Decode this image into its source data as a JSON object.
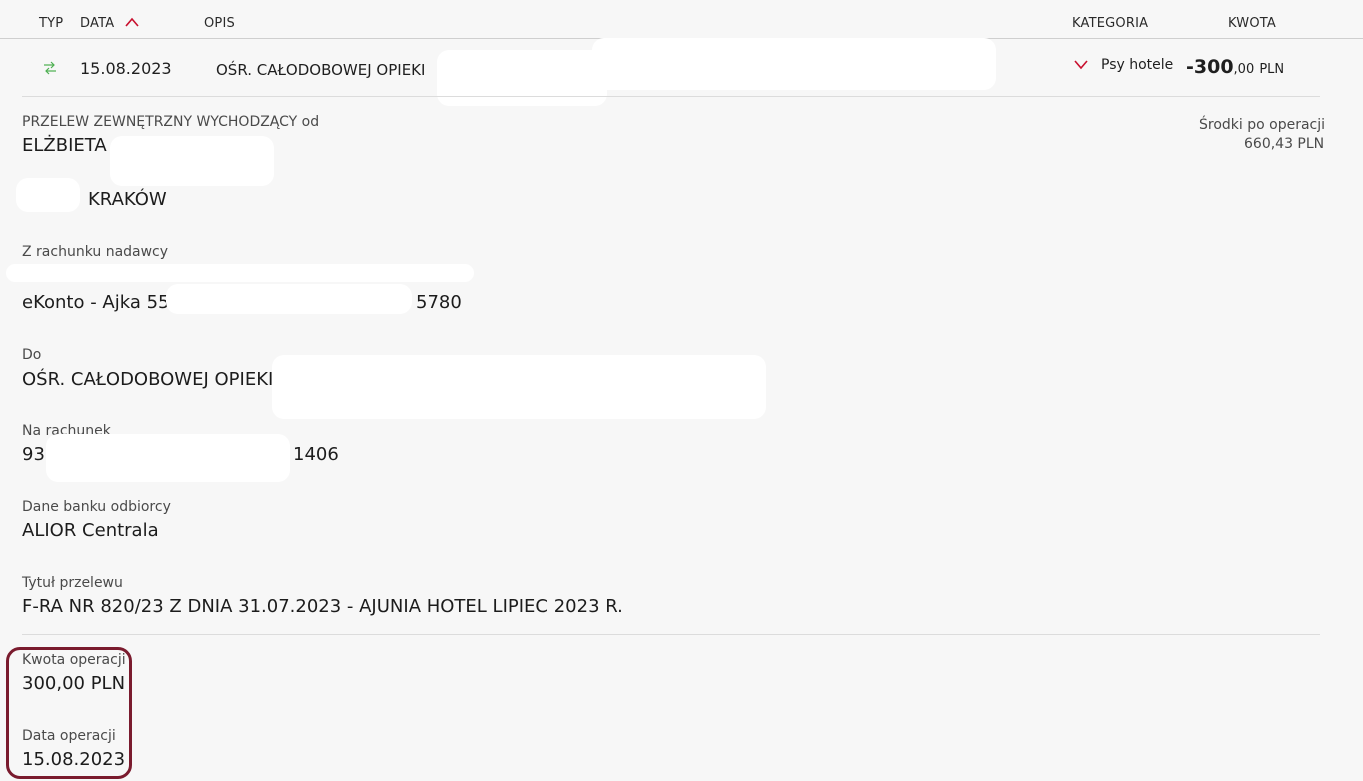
{
  "table_header": {
    "typ": "TYP",
    "data": "DATA",
    "opis": "OPIS",
    "kategoria": "KATEGORIA",
    "kwota": "KWOTA"
  },
  "transaction": {
    "date": "15.08.2023",
    "description": "OŚR. CAŁODOBOWEJ OPIEKI",
    "category": "Psy hotele",
    "amount_main": "-300",
    "amount_decimal": ",00",
    "amount_currency": "PLN"
  },
  "details": {
    "type_label": "PRZELEW ZEWNĘTRZNY WYCHODZĄCY od",
    "sender_name": "ELŻBIETA",
    "sender_city": "KRAKÓW",
    "balance_label": "Środki po operacji",
    "balance_value": "660,43 PLN",
    "from_account_label": "Z rachunku nadawcy",
    "from_account_name": "eKonto - Ajka 55",
    "from_account_end": "5780",
    "to_label": "Do",
    "to_name": "OŚR. CAŁODOBOWEJ OPIEKI",
    "to_account_label": "Na rachunek",
    "to_account_start": "93",
    "to_account_end": "1406",
    "bank_label": "Dane banku odbiorcy",
    "bank_value": "ALIOR Centrala",
    "title_label": "Tytuł przelewu",
    "title_value": "F-RA NR 820/23 Z DNIA 31.07.2023 - AJUNIA HOTEL LIPIEC 2023 R.",
    "op_amount_label": "Kwota operacji",
    "op_amount_value": "300,00 PLN",
    "op_date_label": "Data operacji",
    "op_date_value": "15.08.2023"
  },
  "colors": {
    "accent_red": "#c8102e",
    "transfer_icon_green": "#4caf50",
    "highlight_border": "#7a1b2e"
  },
  "icons": {
    "sort": "chevron-up-icon",
    "type": "transfer-arrows-icon",
    "category": "chevron-down-icon"
  }
}
